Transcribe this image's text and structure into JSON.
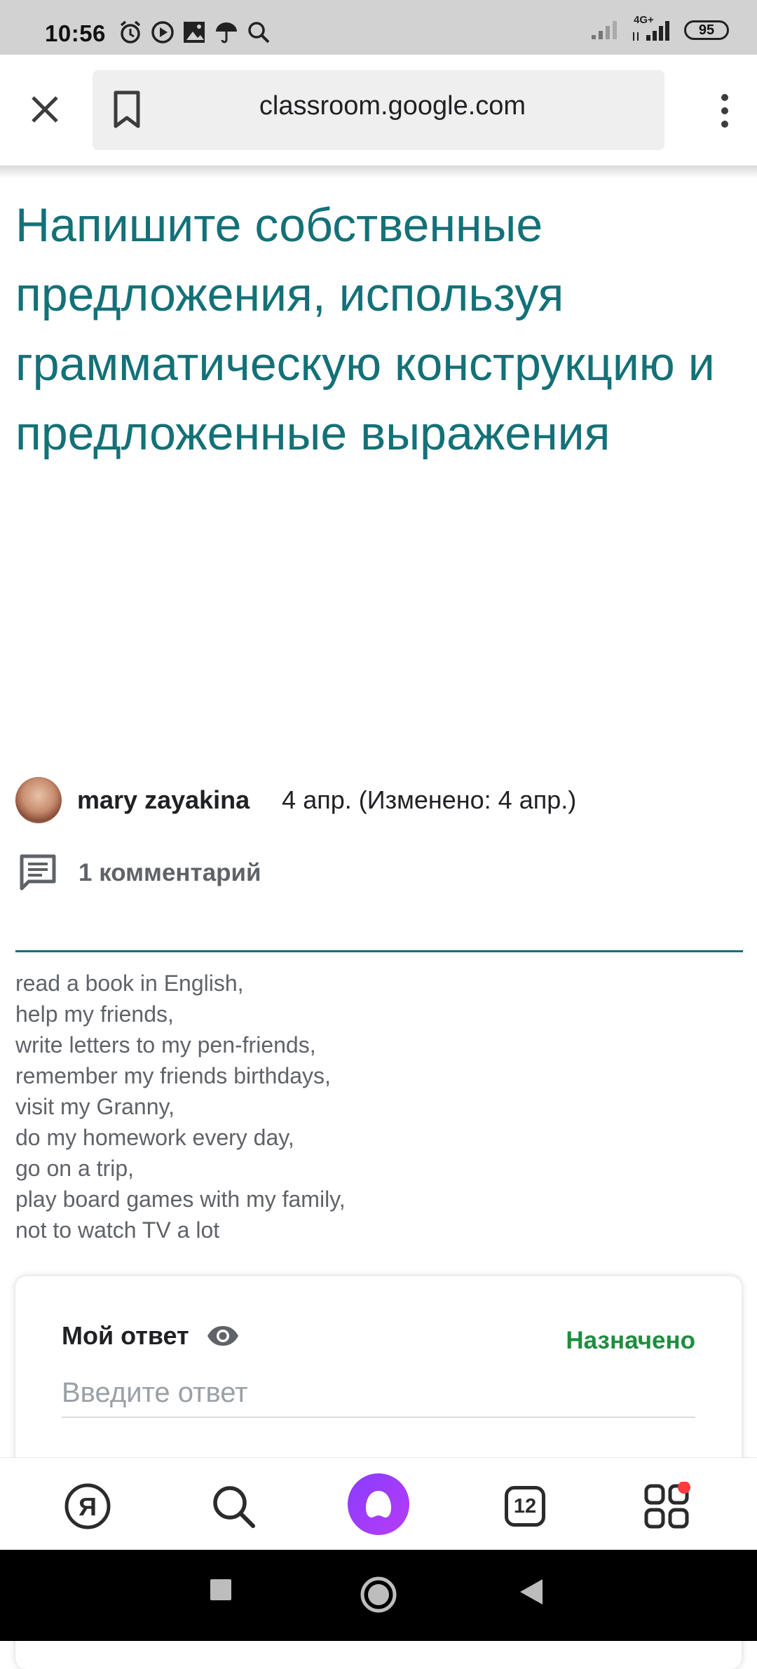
{
  "status_bar": {
    "time": "10:56",
    "icons": [
      "alarm-icon",
      "play-icon",
      "image-icon",
      "umbrella-icon",
      "search-icon"
    ],
    "network": "4G+",
    "battery": "95"
  },
  "browser": {
    "url": "classroom.google.com",
    "tabs_count": "12"
  },
  "assignment": {
    "title": "Напишите собственные предложения, используя грамматическую конструкцию и предложенные выражения",
    "author": "mary zayakina",
    "date": "4 апр. (Изменено: 4 апр.)",
    "comments": "1 комментарий",
    "description": [
      "read a book in English,",
      "help my friends,",
      "write letters to my pen-friends,",
      "remember my friends birthdays,",
      "visit my Granny,",
      "do my homework every day,",
      "go on a trip,",
      "play board games with my family,",
      "not to watch TV a lot"
    ]
  },
  "answer": {
    "title": "Мой ответ",
    "status": "Назначено",
    "placeholder": "Введите ответ"
  },
  "colors": {
    "title": "#137177",
    "status": "#1e8e3e",
    "alice": "#8a3cff"
  }
}
